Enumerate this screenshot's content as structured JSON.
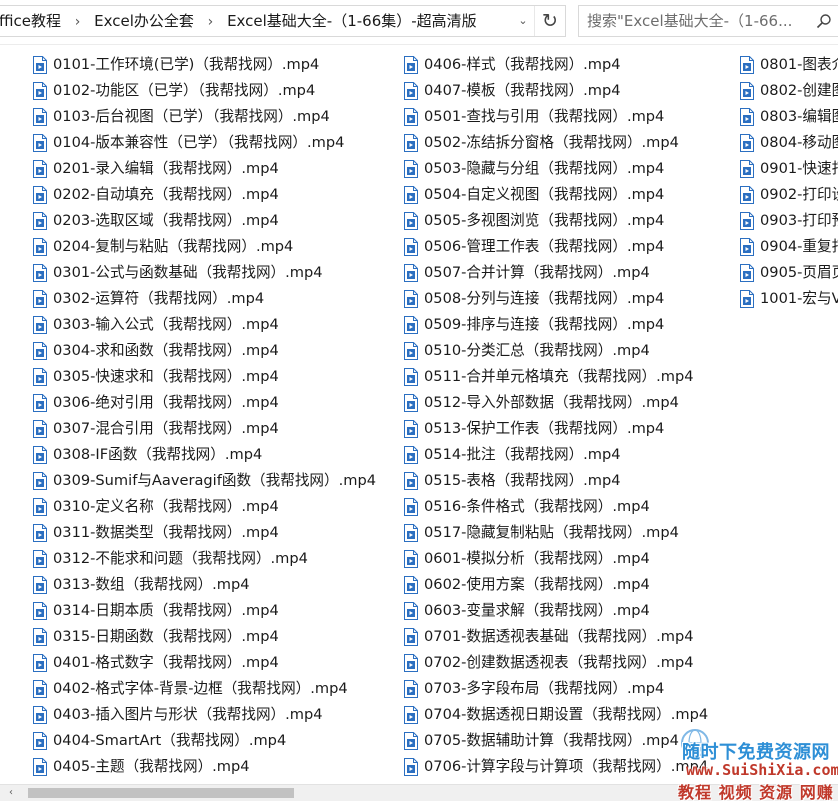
{
  "address_bar": {
    "breadcrumbs": [
      "ffice教程",
      "Excel办公全套",
      "Excel基础大全-（1-66集）-超高清版"
    ],
    "separator": "›",
    "dropdown_glyph": "⌄",
    "refresh_glyph": "↻"
  },
  "search": {
    "placeholder": "搜索\"Excel基础大全-（1-66...",
    "icon": "search-icon"
  },
  "file_icon": "video-file-icon",
  "files": {
    "column1": [
      "0101-工作环境(已学)（我帮找网）.mp4",
      "0102-功能区（已学）（我帮找网）.mp4",
      "0103-后台视图（已学）（我帮找网）.mp4",
      "0104-版本兼容性（已学）（我帮找网）.mp4",
      "0201-录入编辑（我帮找网）.mp4",
      "0202-自动填充（我帮找网）.mp4",
      "0203-选取区域（我帮找网）.mp4",
      "0204-复制与粘贴（我帮找网）.mp4",
      "0301-公式与函数基础（我帮找网）.mp4",
      "0302-运算符（我帮找网）.mp4",
      "0303-输入公式（我帮找网）.mp4",
      "0304-求和函数（我帮找网）.mp4",
      "0305-快速求和（我帮找网）.mp4",
      "0306-绝对引用（我帮找网）.mp4",
      "0307-混合引用（我帮找网）.mp4",
      "0308-IF函数（我帮找网）.mp4",
      "0309-Sumif与Aaveragif函数（我帮找网）.mp4",
      "0310-定义名称（我帮找网）.mp4",
      "0311-数据类型（我帮找网）.mp4",
      "0312-不能求和问题（我帮找网）.mp4",
      "0313-数组（我帮找网）.mp4",
      "0314-日期本质（我帮找网）.mp4",
      "0315-日期函数（我帮找网）.mp4",
      "0401-格式数字（我帮找网）.mp4",
      "0402-格式字体-背景-边框（我帮找网）.mp4",
      "0403-插入图片与形状（我帮找网）.mp4",
      "0404-SmartArt（我帮找网）.mp4",
      "0405-主题（我帮找网）.mp4"
    ],
    "column2": [
      "0406-样式（我帮找网）.mp4",
      "0407-模板（我帮找网）.mp4",
      "0501-查找与引用（我帮找网）.mp4",
      "0502-冻结拆分窗格（我帮找网）.mp4",
      "0503-隐藏与分组（我帮找网）.mp4",
      "0504-自定义视图（我帮找网）.mp4",
      "0505-多视图浏览（我帮找网）.mp4",
      "0506-管理工作表（我帮找网）.mp4",
      "0507-合并计算（我帮找网）.mp4",
      "0508-分列与连接（我帮找网）.mp4",
      "0509-排序与连接（我帮找网）.mp4",
      "0510-分类汇总（我帮找网）.mp4",
      "0511-合并单元格填充（我帮找网）.mp4",
      "0512-导入外部数据（我帮找网）.mp4",
      "0513-保护工作表（我帮找网）.mp4",
      "0514-批注（我帮找网）.mp4",
      "0515-表格（我帮找网）.mp4",
      "0516-条件格式（我帮找网）.mp4",
      "0517-隐藏复制粘贴（我帮找网）.mp4",
      "0601-模拟分析（我帮找网）.mp4",
      "0602-使用方案（我帮找网）.mp4",
      "0603-变量求解（我帮找网）.mp4",
      "0701-数据透视表基础（我帮找网）.mp4",
      "0702-创建数据透视表（我帮找网）.mp4",
      "0703-多字段布局（我帮找网）.mp4",
      "0704-数据透视日期设置（我帮找网）.mp4",
      "0705-数据辅助计算（我帮找网）.mp4",
      "0706-计算字段与计算项（我帮找网）.mp4"
    ],
    "column3": [
      "0801-图表介",
      "0802-创建图",
      "0803-编辑图",
      "0804-移动图",
      "0901-快速打",
      "0902-打印设",
      "0903-打印预",
      "0904-重复打",
      "0905-页眉页",
      "1001-宏与V"
    ]
  },
  "scrollbar": {
    "left_arrow_glyph": "‹"
  },
  "watermark": {
    "line1": "随时下免费资源网",
    "line2": "www.SuiShiXia.com",
    "line3": "教程 视频 资源 网赚"
  },
  "colors": {
    "file_icon_blue": "#2b6fc1",
    "watermark_blue": "#2e8fd6",
    "watermark_red": "#c0392b"
  }
}
